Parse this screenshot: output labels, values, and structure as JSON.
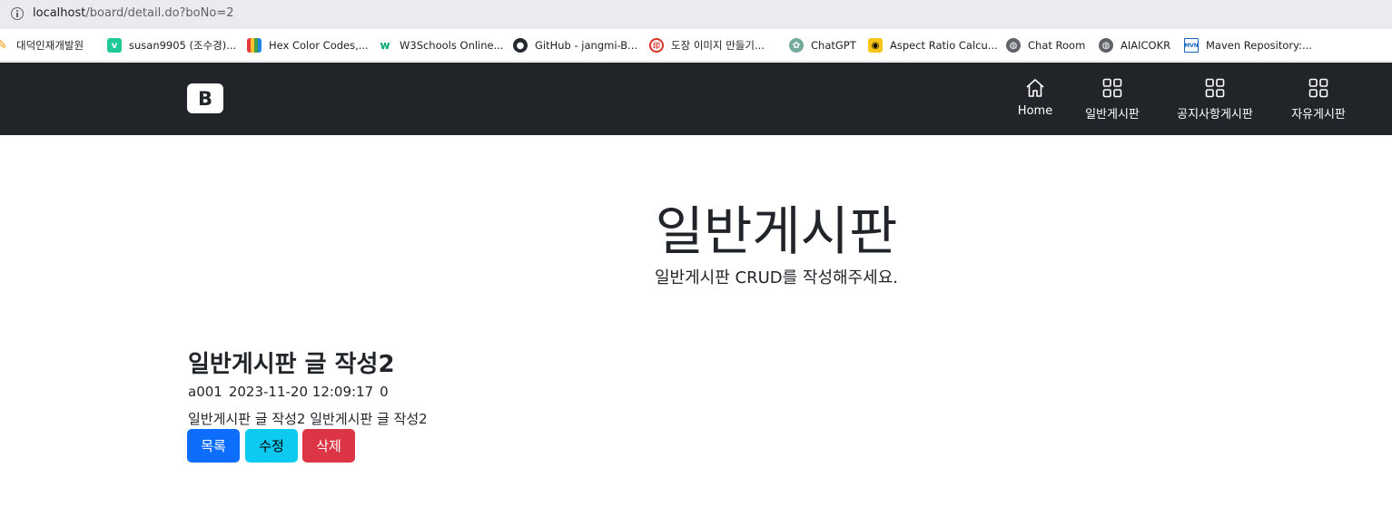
{
  "browser": {
    "url_host": "localhost",
    "url_path": "/board/detail.do?boNo=2"
  },
  "bookmarks": [
    {
      "label": "대덕인재개발원",
      "icon": "pencil-icon",
      "color": "#f29900"
    },
    {
      "label": "susan9905 (조수경)...",
      "icon": "v-icon",
      "color": "#20c997"
    },
    {
      "label": "Hex Color Codes,...",
      "icon": "color-bars-icon",
      "color": "#6f42c1"
    },
    {
      "label": "W3Schools Online...",
      "icon": "w3schools-icon",
      "color": "#04aa6d"
    },
    {
      "label": "GitHub - jangmi-B...",
      "icon": "github-icon",
      "color": "#24292f"
    },
    {
      "label": "도장 이미지 만들기...",
      "icon": "stamp-icon",
      "color": "#d93025"
    },
    {
      "label": "ChatGPT",
      "icon": "chatgpt-icon",
      "color": "#74aa9c"
    },
    {
      "label": "Aspect Ratio Calcu...",
      "icon": "aspect-ratio-icon",
      "color": "#f5c518"
    },
    {
      "label": "Chat Room",
      "icon": "globe-icon",
      "color": "#5f6368"
    },
    {
      "label": "AIAICOKR",
      "icon": "globe-icon",
      "color": "#5f6368"
    },
    {
      "label": "Maven Repository:...",
      "icon": "maven-icon",
      "color": "#1565c0"
    }
  ],
  "navbar": {
    "brand": "B",
    "items": [
      {
        "label": "Home",
        "icon": "home-icon"
      },
      {
        "label": "일반게시판",
        "icon": "grid-icon"
      },
      {
        "label": "공지사항게시판",
        "icon": "grid-icon"
      },
      {
        "label": "자유게시판",
        "icon": "grid-icon"
      }
    ]
  },
  "hero": {
    "title": "일반게시판",
    "subtitle": "일반게시판 CRUD를 작성해주세요."
  },
  "post": {
    "title": "일반게시판 글 작성2",
    "writer": "a001",
    "date": "2023-11-20 12:09:17",
    "hit": "0",
    "content": "일반게시판 글 작성2 일반게시판 글 작성2"
  },
  "actions": {
    "list_label": "목록",
    "edit_label": "수정",
    "delete_label": "삭제"
  }
}
